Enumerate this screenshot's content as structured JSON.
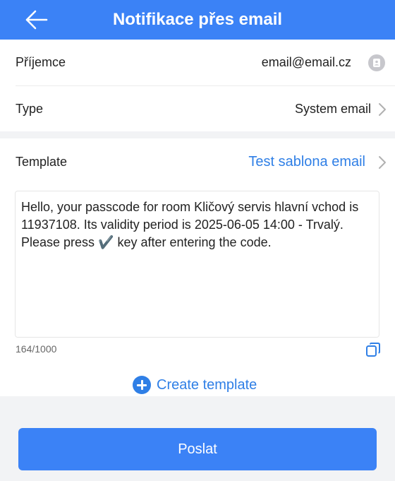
{
  "header": {
    "title": "Notifikace přes email"
  },
  "recipient": {
    "label": "Příjemce",
    "value": "email@email.cz"
  },
  "type": {
    "label": "Type",
    "value": "System email"
  },
  "template": {
    "label": "Template",
    "value": "Test sablona email"
  },
  "message": {
    "text": "Hello, your passcode for room Kličový servis hlavní vchod is 11937108. Its validity period is 2025-06-05 14:00 - Trvalý. Please press ✔️ key after entering the code.",
    "counter": "164/1000"
  },
  "create_template": {
    "label": "Create template"
  },
  "send_button": {
    "label": "Poslat"
  },
  "colors": {
    "accent": "#3b82f6",
    "link": "#2f7fe6",
    "background": "#f2f3f5"
  },
  "icons": [
    "back-arrow-icon",
    "contact-icon",
    "chevron-right-icon",
    "copy-icon",
    "plus-circle-icon"
  ]
}
